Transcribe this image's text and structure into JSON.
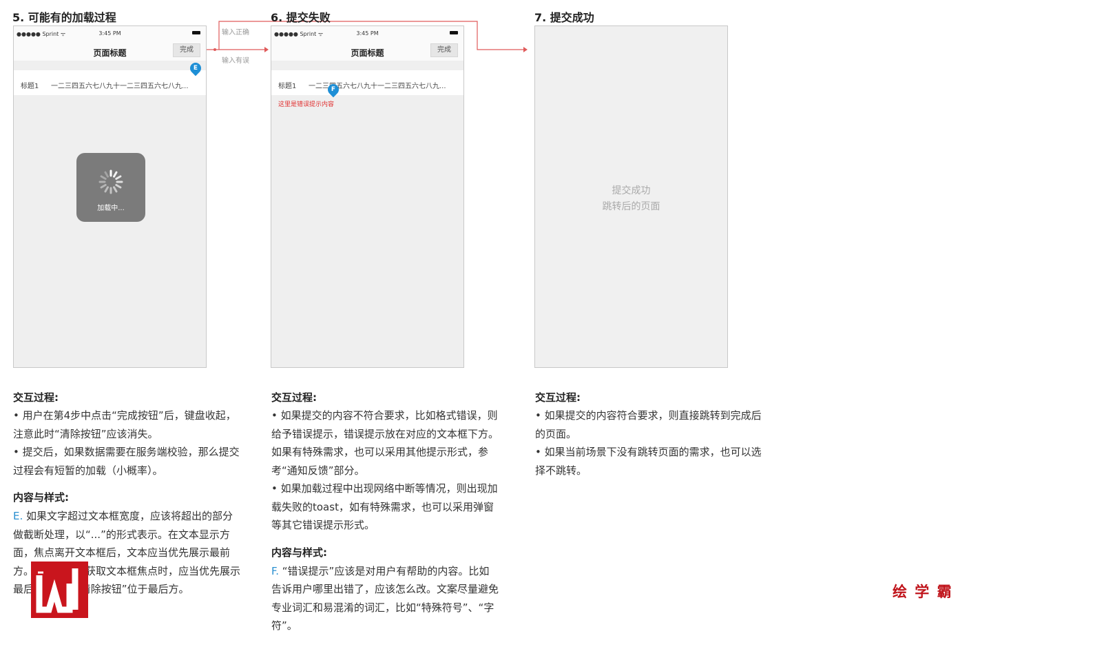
{
  "steps": [
    {
      "title": "5. 可能有的加载过程",
      "phone": {
        "carrier": "●●●●● Sprint ᯤ",
        "time": "3:45 PM",
        "page_title": "页面标题",
        "done_label": "完成",
        "row_label": "标题1",
        "row_value": "一二三四五六七八九十一二三四五六七八九...",
        "marker": "E",
        "loading_text": "加载中..."
      },
      "sections": [
        {
          "heading": "交互过程:",
          "paragraphs": [
            "• 用户在第4步中点击“完成按钮”后，键盘收起，注意此时“清除按钮”应该消失。",
            "• 提交后，如果数据需要在服务端校验，那么提交过程会有短暂的加载（小概率）。"
          ]
        },
        {
          "heading": "内容与样式:",
          "paragraphs": [
            "如果文字超过文本框宽度，应该将超出的部分做截断处理，以“...”的形式表示。在文本显示方面，焦点离开文本框后，文本应当优先展示最前方。当用户再次获取文本框焦点时，应当优先展示最后方，并且“清除按钮”位于最后方。"
          ],
          "letter": "E."
        }
      ]
    },
    {
      "title": "6. 提交失败",
      "phone": {
        "carrier": "●●●●● Sprint ᯤ",
        "time": "3:45 PM",
        "page_title": "页面标题",
        "done_label": "完成",
        "row_label": "标题1",
        "row_value": "一二三四五六七八九十一二三四五六七八九...",
        "marker": "F",
        "error_text": "这里是错误提示内容"
      },
      "sections": [
        {
          "heading": "交互过程:",
          "paragraphs": [
            "• 如果提交的内容不符合要求，比如格式错误，则给予错误提示，错误提示放在对应的文本框下方。如果有特殊需求，也可以采用其他提示形式，参考“通知反馈”部分。",
            "• 如果加载过程中出现网络中断等情况，则出现加载失败的toast，如有特殊需求，也可以采用弹窗等其它错误提示形式。"
          ]
        },
        {
          "heading": "内容与样式:",
          "paragraphs": [
            "“错误提示”应该是对用户有帮助的内容。比如告诉用户哪里出错了，应该怎么改。文案尽量避免专业词汇和易混淆的词汇，比如“特殊符号”、“字符”。"
          ],
          "letter": "F."
        }
      ]
    },
    {
      "title": "7. 提交成功",
      "phone": {
        "placeholder_line1": "提交成功",
        "placeholder_line2": "跳转后的页面"
      },
      "sections": [
        {
          "heading": "交互过程:",
          "paragraphs": [
            "• 如果提交的内容符合要求，则直接跳转到完成后的页面。",
            "• 如果当前场景下没有跳转页面的需求，也可以选择不跳转。"
          ]
        }
      ]
    }
  ],
  "flow": {
    "correct_label": "输入正确",
    "wrong_label": "输入有误",
    "arrow_color": "#e05a5a"
  },
  "watermark": {
    "brand_text": "绘 学 霸",
    "brand_color": "#c0141b"
  },
  "colors": {
    "marker": "#1e8fd6",
    "error": "#e03030",
    "accent_letter": "#2a8fd0"
  }
}
